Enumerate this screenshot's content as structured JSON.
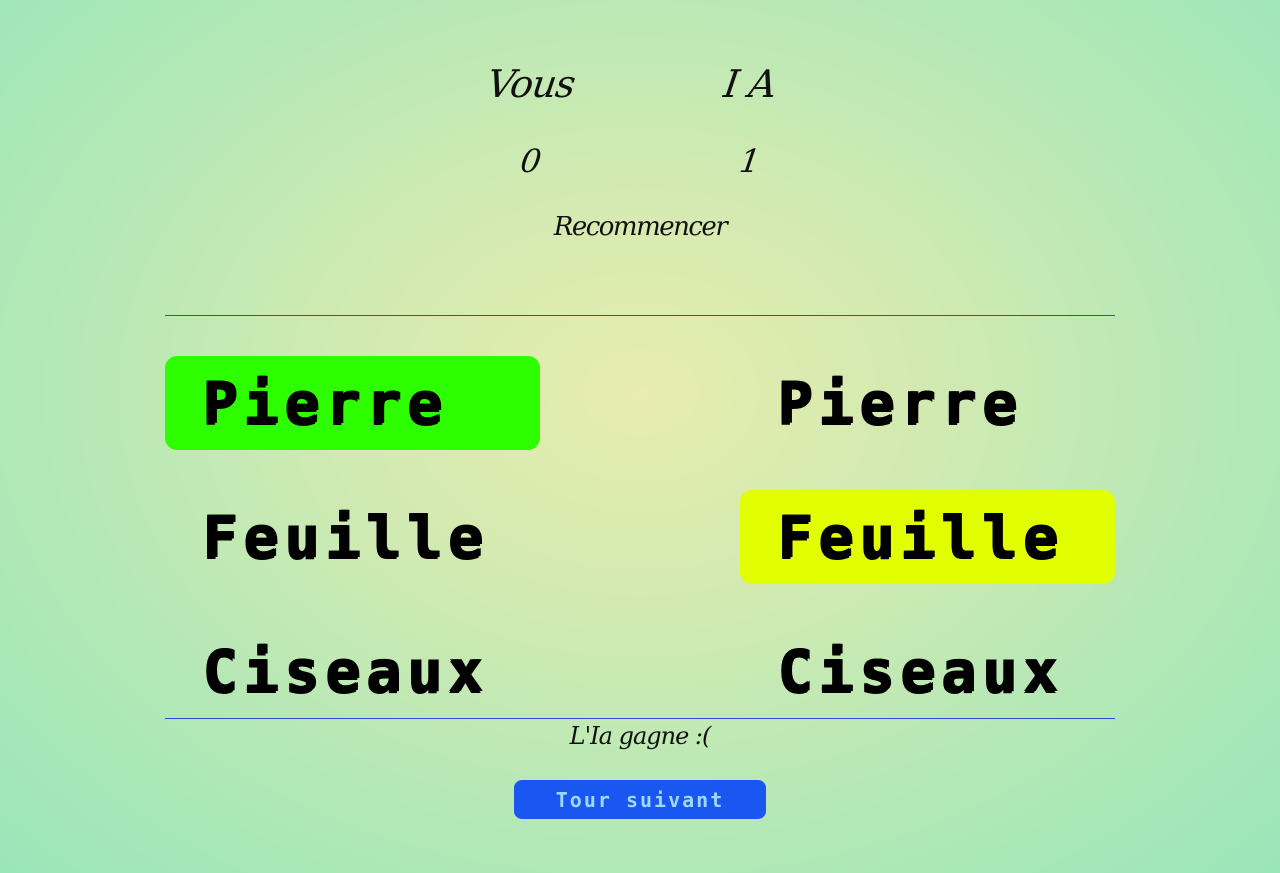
{
  "scoreboard": {
    "player_label": "Vous",
    "ai_label": "I A",
    "player_score": "0",
    "ai_score": "1",
    "restart_label": "Recommencer"
  },
  "player_choices": [
    {
      "label": "Pierre",
      "selected": true
    },
    {
      "label": "Feuille",
      "selected": false
    },
    {
      "label": "Ciseaux",
      "selected": false
    }
  ],
  "ai_choices": [
    {
      "label": "Pierre",
      "selected": false
    },
    {
      "label": "Feuille",
      "selected": true
    },
    {
      "label": "Ciseaux",
      "selected": false
    }
  ],
  "result_text": "L'Ia gagne :(",
  "next_button_label": "Tour suivant",
  "colors": {
    "player_selected": "#2eff00",
    "ai_selected": "#e1ff00",
    "button": "#1a56f0",
    "button_text": "#9fd8ff",
    "divider": "#2a4fd8"
  }
}
